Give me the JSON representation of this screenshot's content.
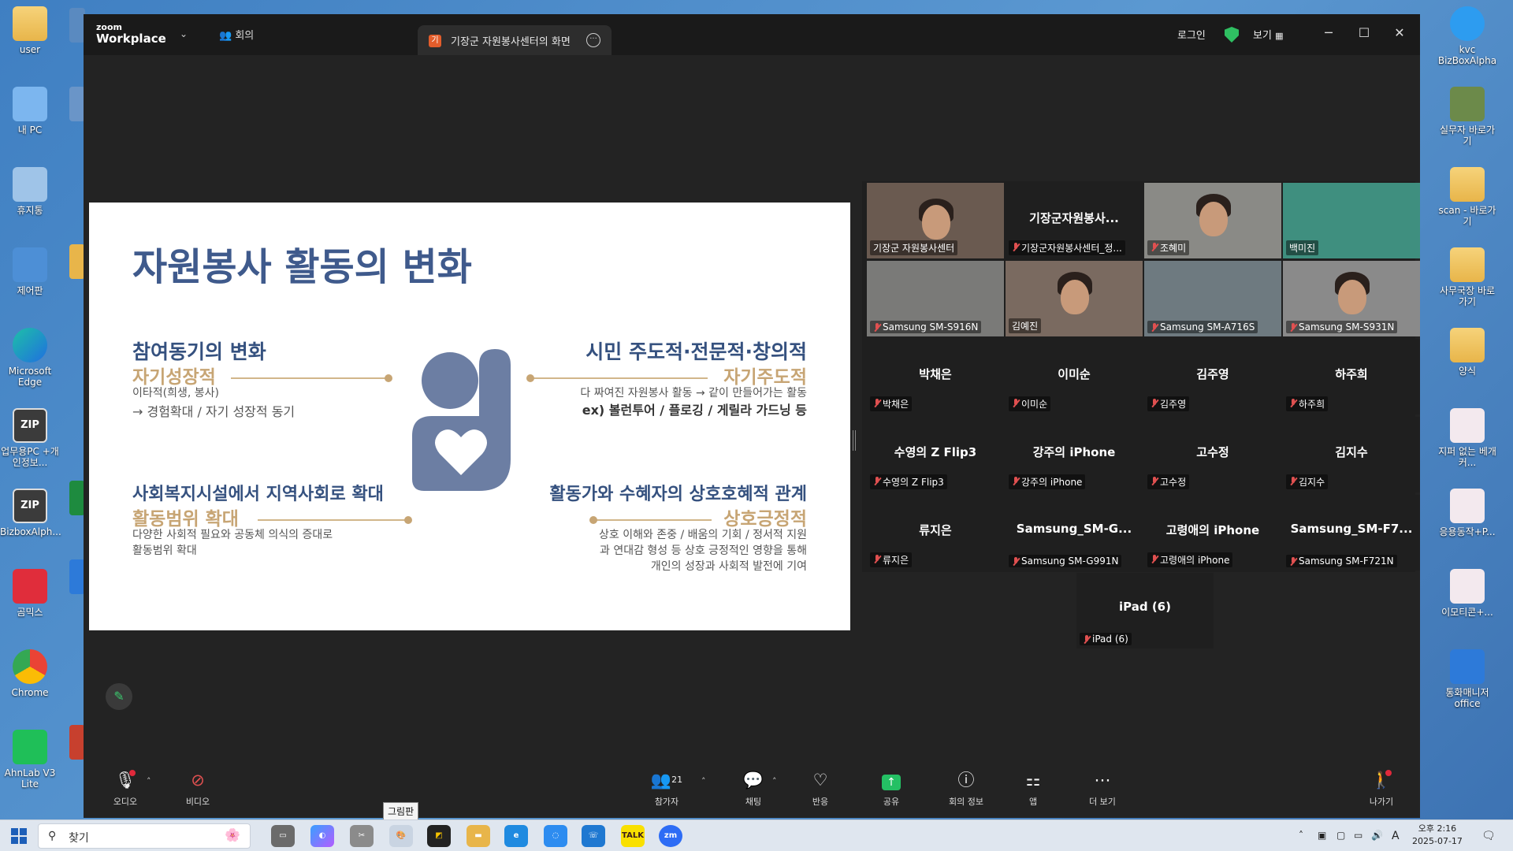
{
  "desktop": {
    "left_icons": [
      {
        "label": "user",
        "type": "folder"
      },
      {
        "label": "내 PC",
        "type": "pc"
      },
      {
        "label": "휴지통",
        "type": "bin"
      },
      {
        "label": "제어판",
        "type": "panel"
      },
      {
        "label": "Microsoft Edge",
        "type": "edge"
      },
      {
        "label": "업무용PC +개인정보...",
        "type": "zip"
      },
      {
        "label": "BizboxAlph...",
        "type": "zip"
      },
      {
        "label": "곰믹스",
        "type": "gom"
      },
      {
        "label": "Chrome",
        "type": "chrome"
      },
      {
        "label": "AhnLab V3 Lite",
        "type": "v3"
      }
    ],
    "right_icons": [
      {
        "label": "kvc BizBoxAlpha",
        "type": "chat"
      },
      {
        "label": "실무자 바로가기",
        "type": "person"
      },
      {
        "label": "scan - 바로가기",
        "type": "folder"
      },
      {
        "label": "사무국장 바로가기",
        "type": "folder"
      },
      {
        "label": "양식",
        "type": "folder"
      },
      {
        "label": "지퍼 없는 베개 커...",
        "type": "doc"
      },
      {
        "label": "응용동작+P...",
        "type": "doc"
      },
      {
        "label": "이모티콘+...",
        "type": "doc"
      },
      {
        "label": "통화매니저 office",
        "type": "kt"
      }
    ]
  },
  "zoom": {
    "logo_top": "zoom",
    "logo_bottom": "Workplace",
    "meeting_label": "회의",
    "share_tab_badge": "기",
    "share_tab_label": "기장군 자원봉사센터의 화면",
    "login": "로그인",
    "view": "보기",
    "slide": {
      "title": "자원봉사 활동의 변화",
      "q1": {
        "head": "참여동기의 변화",
        "sub": "자기성장적",
        "line1": "이타적(희생, 봉사)",
        "line2": "→ 경험확대 / 자기 성장적 동기"
      },
      "q2": {
        "head": "시민 주도적·전문적·창의적",
        "sub": "자기주도적",
        "line1": "다 짜여진 자원봉사 활동 → 같이 만들어가는 활동",
        "line2": "ex) 볼런투어 / 플로깅 / 게릴라 가드닝 등"
      },
      "q3": {
        "head": "사회복지시설에서 지역사회로 확대",
        "sub": "활동범위 확대",
        "line1": "다양한 사회적 필요와 공동체 의식의 증대로",
        "line2": "활동범위 확대"
      },
      "q4": {
        "head": "활동가와 수혜자의 상호호혜적 관계",
        "sub": "상호긍정적",
        "line1": "상호 이해와 존중 / 배움의 기회 / 정서적 지원",
        "line2": "과 연대감 형성 등 상호 긍정적인 영향을 통해",
        "line3": "개인의 성장과 사회적 발전에 기여"
      }
    },
    "participants": [
      {
        "big": "",
        "label": "기장군 자원봉사센터",
        "muted": false,
        "video": true,
        "active": true
      },
      {
        "big": "기장군자원봉사...",
        "label": "기장군자원봉사센터_정...",
        "muted": true,
        "video": false
      },
      {
        "big": "",
        "label": "조혜미",
        "muted": true,
        "video": true
      },
      {
        "big": "",
        "label": "백미진",
        "muted": false,
        "video": true
      },
      {
        "big": "",
        "label": "Samsung SM-S916N",
        "muted": true,
        "video": true
      },
      {
        "big": "",
        "label": "김예진",
        "muted": false,
        "video": true
      },
      {
        "big": "",
        "label": "Samsung SM-A716S",
        "muted": true,
        "video": true
      },
      {
        "big": "",
        "label": "Samsung SM-S931N",
        "muted": true,
        "video": true
      },
      {
        "big": "박채은",
        "label": "박채은",
        "muted": true,
        "video": false
      },
      {
        "big": "이미순",
        "label": "이미순",
        "muted": true,
        "video": false
      },
      {
        "big": "김주영",
        "label": "김주영",
        "muted": true,
        "video": false
      },
      {
        "big": "하주희",
        "label": "하주희",
        "muted": true,
        "video": false
      },
      {
        "big": "수영의 Z Flip3",
        "label": "수영의 Z Flip3",
        "muted": true,
        "video": false
      },
      {
        "big": "강주의 iPhone",
        "label": "강주의 iPhone",
        "muted": true,
        "video": false
      },
      {
        "big": "고수정",
        "label": "고수정",
        "muted": true,
        "video": false
      },
      {
        "big": "김지수",
        "label": "김지수",
        "muted": true,
        "video": false
      },
      {
        "big": "류지은",
        "label": "류지은",
        "muted": true,
        "video": false
      },
      {
        "big": "Samsung_SM-G...",
        "label": "Samsung SM-G991N",
        "muted": true,
        "video": false
      },
      {
        "big": "고령애의 iPhone",
        "label": "고령애의 iPhone",
        "muted": true,
        "video": false
      },
      {
        "big": "Samsung_SM-F7...",
        "label": "Samsung SM-F721N",
        "muted": true,
        "video": false
      },
      {
        "big": "iPad (6)",
        "label": "iPad (6)",
        "muted": true,
        "video": false
      }
    ],
    "toolbar": {
      "audio": "오디오",
      "video": "비디오",
      "participants": "참가자",
      "participants_count": "21",
      "chat": "채팅",
      "react": "반응",
      "share": "공유",
      "info": "회의 정보",
      "apps": "앱",
      "more": "더 보기",
      "leave": "나가기"
    }
  },
  "taskbar": {
    "search_placeholder": "찾기",
    "tooltip": "그림판",
    "tray_lang": "A",
    "time": "오후 2:16",
    "date": "2025-07-17"
  }
}
